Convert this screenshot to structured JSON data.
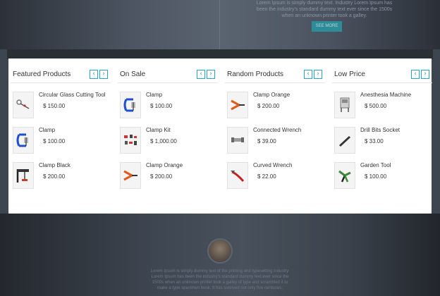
{
  "hero": {
    "text": "Lorem Ipsum is simply dummy text. Industry Lorem Ipsum has been the industry's standard dummy text ever since the 1500s when an unknown printer took a galley.",
    "button_label": "SEE MORE"
  },
  "testimonial": {
    "text": "Lorem Ipsum is simply dummy text of the printing and typesetting industry. Lorem Ipsum has been the industry's standard dummy text ever since the 1500s when an unknown printer took a galley of type and scrambled it to make a type specimen book. It has survived not only five centuries."
  },
  "colors": {
    "accent": "#23a8c9",
    "panel_bg": "#ffffff",
    "backdrop": "#3d4550"
  },
  "nav": {
    "prev_icon": "chevron-left-icon",
    "next_icon": "chevron-right-icon",
    "prev_glyph": "‹",
    "next_glyph": "›"
  },
  "columns": [
    {
      "title": "Featured Products",
      "products": [
        {
          "name": "Circular Glass Cutting Tool",
          "price": "$ 150.00",
          "icon": "glass-cutter-icon"
        },
        {
          "name": "Clamp",
          "price": "$ 100.00",
          "icon": "clamp-icon"
        },
        {
          "name": "Clamp Black",
          "price": "$ 200.00",
          "icon": "bar-clamp-icon"
        }
      ]
    },
    {
      "title": "On Sale",
      "products": [
        {
          "name": "Clamp",
          "price": "$ 100.00",
          "icon": "clamp-icon"
        },
        {
          "name": "Clamp Kit",
          "price": "$ 1,000.00",
          "icon": "clamp-kit-icon"
        },
        {
          "name": "Clamp Orange",
          "price": "$ 200.00",
          "icon": "orange-clamp-icon"
        }
      ]
    },
    {
      "title": "Random Products",
      "products": [
        {
          "name": "Clamp Orange",
          "price": "$ 200.00",
          "icon": "orange-clamp-icon"
        },
        {
          "name": "Connected Wrench",
          "price": "$ 39.00",
          "icon": "wrench-icon"
        },
        {
          "name": "Curved Wrench",
          "price": "$ 22.00",
          "icon": "curved-wrench-icon"
        }
      ]
    },
    {
      "title": "Low Price",
      "products": [
        {
          "name": "Anesthesia Machine",
          "price": "$ 500.00",
          "icon": "machine-icon"
        },
        {
          "name": "Drill Bits Socket",
          "price": "$ 33.00",
          "icon": "drill-bit-icon"
        },
        {
          "name": "Garden Tool",
          "price": "$ 100.00",
          "icon": "pruner-icon"
        }
      ]
    }
  ]
}
